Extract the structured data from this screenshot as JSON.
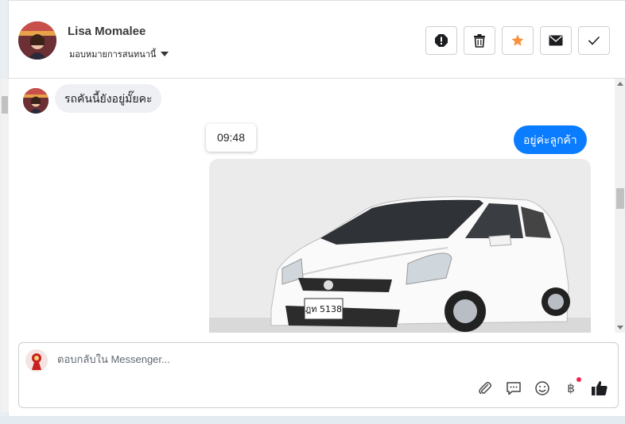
{
  "contact": {
    "name": "Lisa Momalee",
    "assign_label": "มอบหมายการสนทนานี้"
  },
  "header_actions": [
    {
      "name": "spam-icon"
    },
    {
      "name": "trash-icon"
    },
    {
      "name": "star-icon",
      "color": "#f7923b"
    },
    {
      "name": "envelope-icon"
    },
    {
      "name": "check-icon"
    }
  ],
  "thread": {
    "incoming_text": "รถคันนี้ยังอยู่มั๊ยคะ",
    "timestamp": "09:48",
    "outgoing_text": "อยู่ค่ะลูกค้า",
    "image": {
      "description": "car-photo",
      "plate": "ฎท 5138"
    }
  },
  "composer": {
    "placeholder": "ตอบกลับใน Messenger..."
  },
  "composer_tools": {
    "currency": "฿"
  },
  "colors": {
    "accent": "#0a7cff",
    "star": "#f7923b",
    "notify": "#f0284a"
  }
}
